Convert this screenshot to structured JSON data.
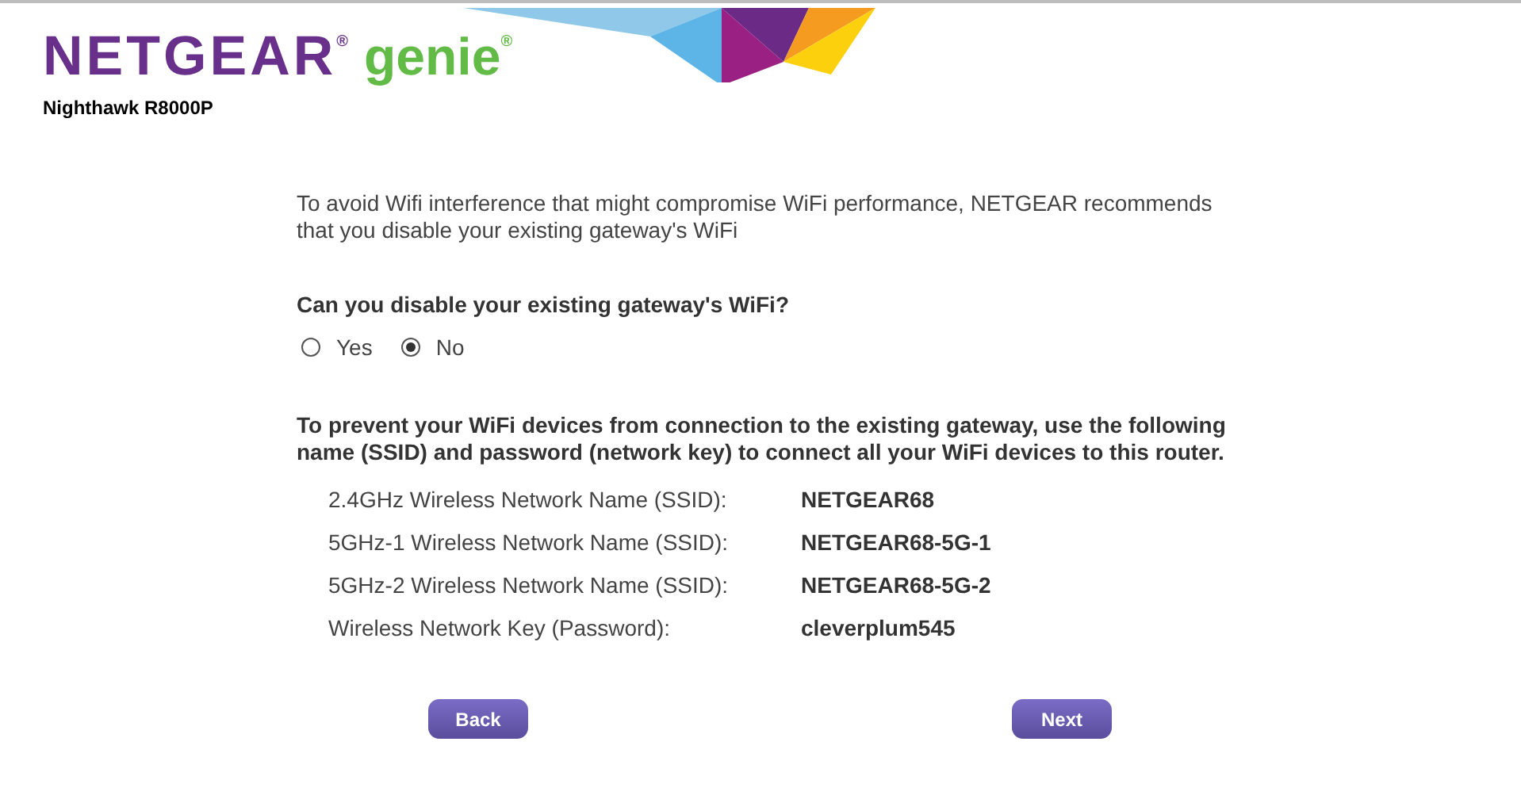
{
  "header": {
    "brand": "NETGEAR$^{®}$",
    "product": "genie$^{®}$",
    "model": "Nighthawk R8000P"
  },
  "intro": "To avoid Wifi interference that might compromise WiFi performance, NETGEAR recommends that you disable your existing gateway's WiFi",
  "question": "Can you disable your existing gateway's WiFi?",
  "options": [
    {
      "label": "Yes",
      "selected": false
    },
    {
      "label": "No",
      "selected": true
    }
  ],
  "instructions": "To prevent your WiFi devices from connection to the existing gateway, use the following name (SSID) and password (network key) to connect all your WiFi devices to this router.",
  "settings": [
    {
      "label": "2.4GHz Wireless Network Name (SSID):",
      "value": "NETGEAR68"
    },
    {
      "label": "5GHz-1 Wireless Network Name (SSID):",
      "value": "NETGEAR68-5G-1"
    },
    {
      "label": "5GHz-2 Wireless Network Name (SSID):",
      "value": "NETGEAR68-5G-2"
    },
    {
      "label": "Wireless Network Key (Password):",
      "value": "cleverplum545"
    }
  ],
  "buttons": {
    "back": "Back",
    "next": "Next"
  }
}
